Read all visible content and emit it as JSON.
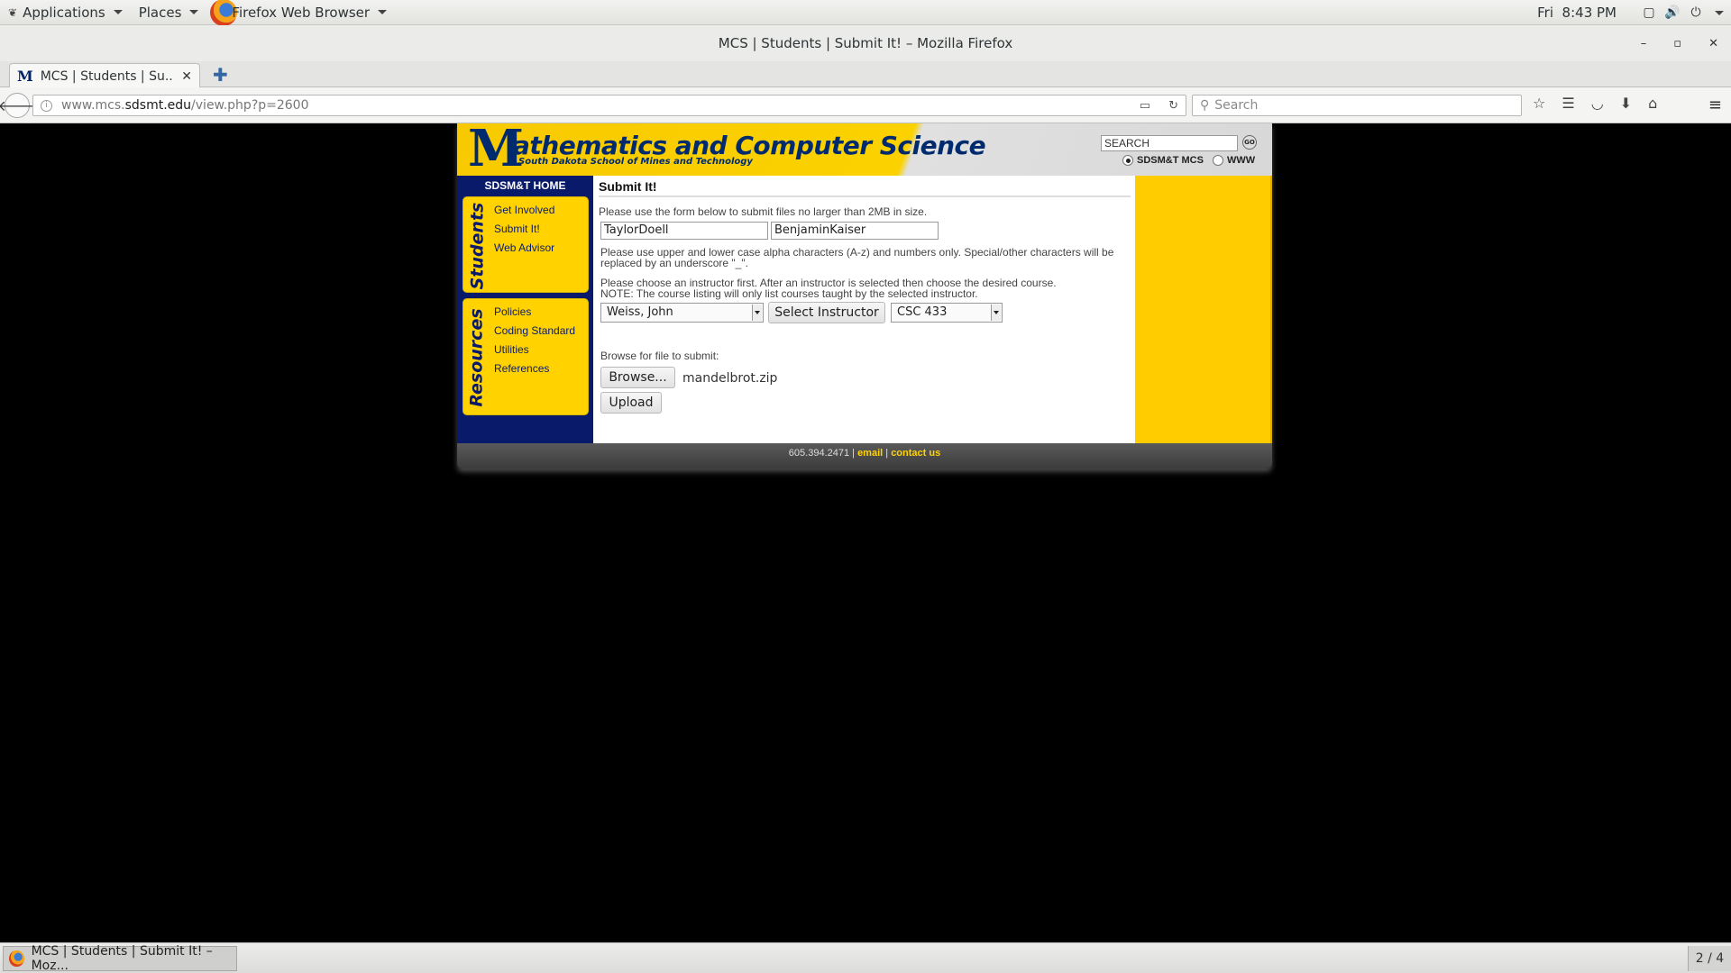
{
  "topbar": {
    "applications": "Applications",
    "places": "Places",
    "browser_menu": "Firefox Web Browser",
    "clock": "Fri  8:43 PM"
  },
  "window": {
    "title": "MCS | Students | Submit It! – Mozilla Firefox",
    "minimize": "–",
    "maximize": "▫",
    "close": "✕"
  },
  "tab": {
    "label": "MCS | Students | Su...",
    "favicon": "M"
  },
  "navbar": {
    "url_prefix": "www.mcs.",
    "url_domain": "sdsmt.edu",
    "url_path": "/view.php?p=2600",
    "search_placeholder": "Search"
  },
  "site": {
    "header_m": "M",
    "header_title": "athematics and Computer Science",
    "header_subtitle": "South Dakota School of Mines and Technology",
    "search_value": "SEARCH",
    "go_label": "GO",
    "scope_1": "SDSM&T MCS",
    "scope_2": "WWW",
    "home_link": "SDSM&T HOME",
    "students_label": "Students",
    "students_items": [
      "Get Involved",
      "Submit It!",
      "Web Advisor"
    ],
    "resources_label": "Resources",
    "resources_items": [
      "Policies",
      "Coding Standard",
      "Utilities",
      "References"
    ]
  },
  "form": {
    "heading": "Submit It!",
    "intro": "Please use the form below to submit files no larger than 2MB in size.",
    "name1": "TaylorDoell",
    "name2": "BenjaminKaiser",
    "chars_note": "Please use upper and lower case alpha characters (A-z) and numbers only. Special/other characters will be replaced by an underscore \"_\".",
    "instructor_note_1": "Please choose an instructor first. After an instructor is selected then choose the desired course.",
    "instructor_note_2": "NOTE: The course listing will only list courses taught by the selected instructor.",
    "instructor": "Weiss, John",
    "select_instructor": "Select Instructor",
    "course": "CSC 433",
    "browse_label": "Browse for file to submit:",
    "browse_button": "Browse...",
    "file_name": "mandelbrot.zip",
    "upload_button": "Upload"
  },
  "footer": {
    "phone": "605.394.2471 |",
    "email": "email",
    "sep": "|",
    "contact": "contact us"
  },
  "taskbar": {
    "task": "MCS | Students | Submit It! – Moz...",
    "workspace": "2 / 4"
  }
}
